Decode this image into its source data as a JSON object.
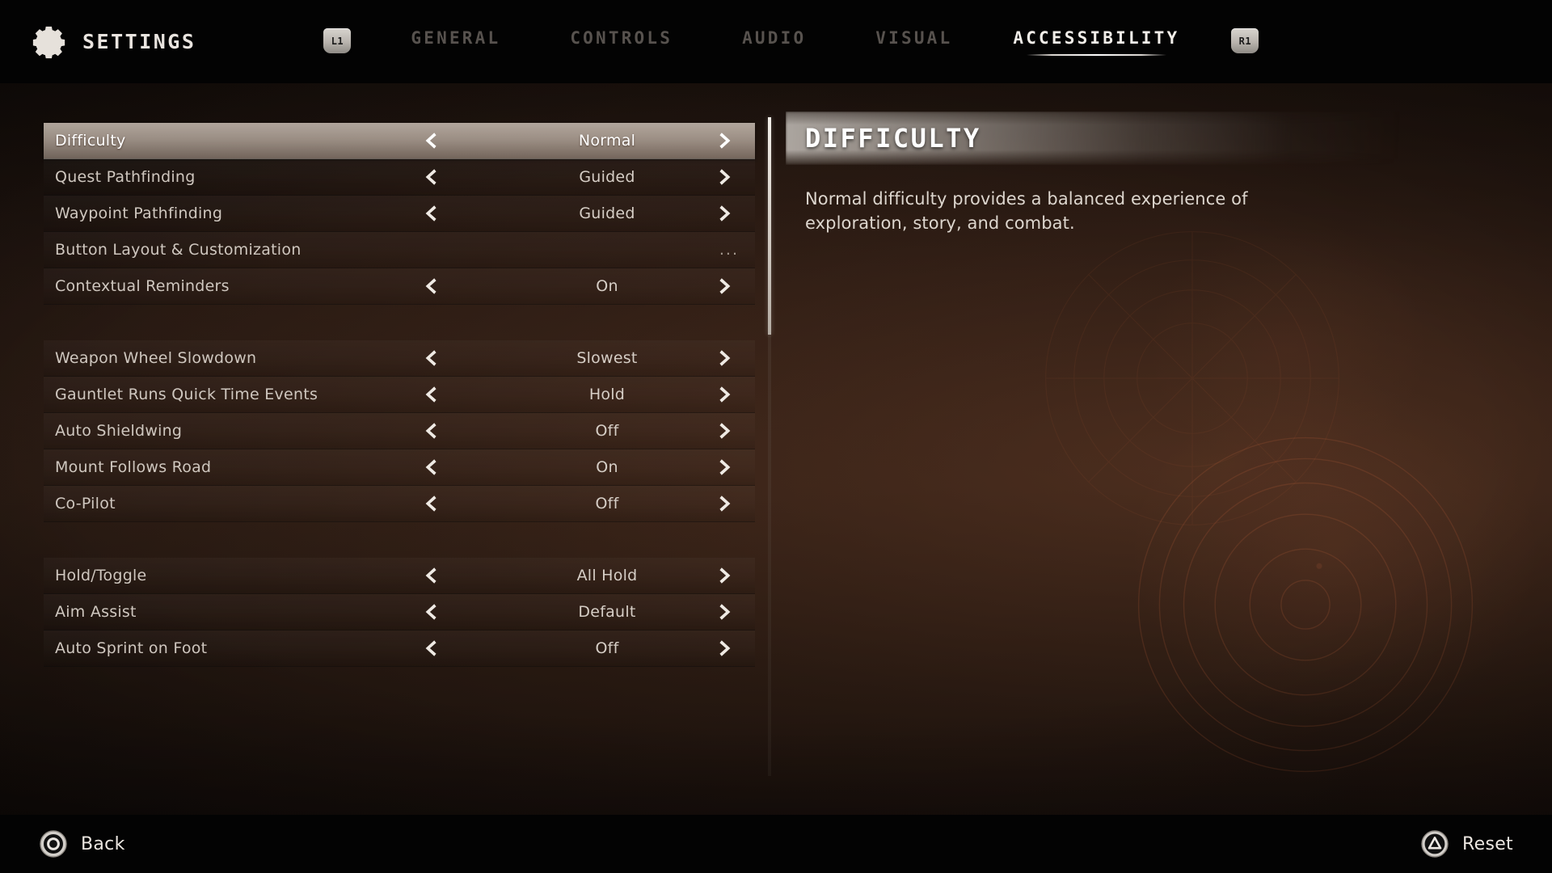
{
  "header": {
    "gear_icon": "gear-icon",
    "title": "SETTINGS",
    "left_bumper": "L1",
    "right_bumper": "R1",
    "tabs": [
      {
        "label": "GENERAL",
        "active": false
      },
      {
        "label": "CONTROLS",
        "active": false
      },
      {
        "label": "AUDIO",
        "active": false
      },
      {
        "label": "VISUAL",
        "active": false
      },
      {
        "label": "ACCESSIBILITY",
        "active": true
      }
    ]
  },
  "settings": {
    "groups": [
      {
        "rows": [
          {
            "label": "Difficulty",
            "value": "Normal",
            "type": "stepper",
            "selected": true
          },
          {
            "label": "Quest Pathfinding",
            "value": "Guided",
            "type": "stepper",
            "selected": false
          },
          {
            "label": "Waypoint Pathfinding",
            "value": "Guided",
            "type": "stepper",
            "selected": false
          },
          {
            "label": "Button Layout & Customization",
            "value": "...",
            "type": "submenu",
            "selected": false
          },
          {
            "label": "Contextual Reminders",
            "value": "On",
            "type": "stepper",
            "selected": false
          }
        ]
      },
      {
        "rows": [
          {
            "label": "Weapon Wheel Slowdown",
            "value": "Slowest",
            "type": "stepper",
            "selected": false
          },
          {
            "label": "Gauntlet Runs Quick Time Events",
            "value": "Hold",
            "type": "stepper",
            "selected": false
          },
          {
            "label": "Auto Shieldwing",
            "value": "Off",
            "type": "stepper",
            "selected": false
          },
          {
            "label": "Mount Follows Road",
            "value": "On",
            "type": "stepper",
            "selected": false
          },
          {
            "label": "Co-Pilot",
            "value": "Off",
            "type": "stepper",
            "selected": false
          }
        ]
      },
      {
        "rows": [
          {
            "label": "Hold/Toggle",
            "value": "All Hold",
            "type": "stepper",
            "selected": false
          },
          {
            "label": "Aim Assist",
            "value": "Default",
            "type": "stepper",
            "selected": false
          },
          {
            "label": "Auto Sprint on Foot",
            "value": "Off",
            "type": "stepper",
            "selected": false
          }
        ]
      }
    ],
    "left_arrow_icon": "chevron-left-icon",
    "right_arrow_icon": "chevron-right-icon",
    "scrollbar": {
      "thumb_top_pct": 0,
      "thumb_height_pct": 33
    }
  },
  "detail": {
    "title": "DIFFICULTY",
    "description": "Normal difficulty provides a balanced experience of exploration, story, and combat."
  },
  "footer": {
    "back": {
      "icon": "circle-button-icon",
      "label": "Back"
    },
    "reset": {
      "icon": "triangle-button-icon",
      "label": "Reset"
    }
  },
  "colors": {
    "accent_selected": "#d7cbc0",
    "text_primary": "#e8e2dc",
    "text_dim": "#57524e",
    "bar_background": "#030303"
  }
}
